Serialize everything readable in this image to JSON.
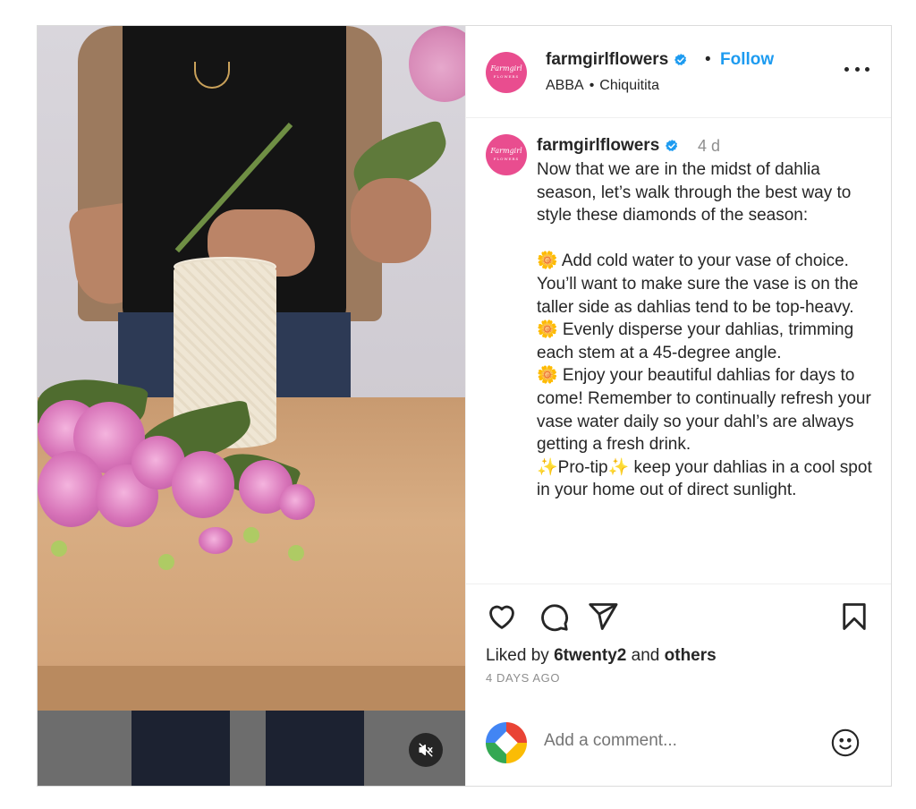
{
  "post": {
    "author": "farmgirlflowers",
    "avatar_brand": "Farmgirl",
    "avatar_brand_sub": "FLOWERS",
    "dot": "•",
    "follow_label": "Follow",
    "audio": {
      "artist": "ABBA",
      "separator": "•",
      "track": "Chiquitita"
    },
    "caption": {
      "time": "4 d",
      "text": "Now that we are in the midst of dahlia season, let’s walk through the best way to style these diamonds of the season:\n\n🌼 Add cold water to your vase of choice. You’ll want to make sure the vase is on the taller side as dahlias tend to be top-heavy.\n🌼 Evenly disperse your dahlias, trimming each stem at a 45-degree angle.\n🌼 Enjoy your beautiful dahlias for days to come! Remember to continually refresh your vase water daily so your dahl’s are always getting a fresh drink.\n✨Pro-tip✨ keep your dahlias in a cool spot in your home out of direct sunlight."
    },
    "likes": {
      "prefix": "Liked by",
      "user": "6twenty2",
      "conjunction": "and",
      "others": "others"
    },
    "posted_ago": "4 DAYS AGO",
    "comment": {
      "placeholder": "Add a comment..."
    }
  },
  "colors": {
    "link_blue": "#1d9bf0",
    "avatar_pink": "#e94d8f",
    "muted_text": "#8e8e8e"
  },
  "icons": [
    "verified-badge-icon",
    "more-options-icon",
    "heart-icon",
    "comment-icon",
    "share-icon",
    "bookmark-icon",
    "emoji-icon",
    "mute-icon"
  ]
}
